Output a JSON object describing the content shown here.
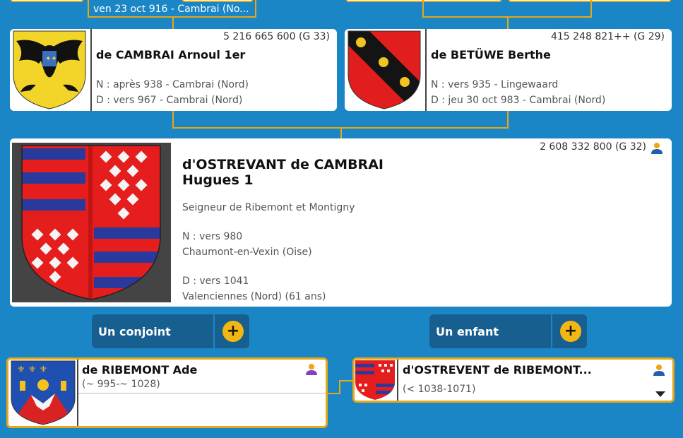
{
  "colors": {
    "background": "#1b86c6",
    "connector": "#e8a716",
    "button": "#175f8f",
    "plus": "#f2b713"
  },
  "top_marriage": {
    "text": "ven 23 oct 916 - Cambrai (No..."
  },
  "father": {
    "sosa": "5 216 665 600 (G 33)",
    "name": "de CAMBRAI Arnoul 1er",
    "birth": "N : après 938 - Cambrai (Nord)",
    "death": "D : vers 967 - Cambrai (Nord)"
  },
  "mother": {
    "sosa": "415 248 821++ (G 29)",
    "name": "de BETÜWE Berthe",
    "birth": "N : vers 935 - Lingewaard",
    "death": "D : jeu 30 oct 983 - Cambrai (Nord)"
  },
  "main": {
    "sosa": "2 608 332 800 (G 32)",
    "surname": "d'OSTREVANT de CAMBRAI",
    "given": "Hugues 1",
    "title": "Seigneur de Ribemont et Montigny",
    "birth": "N : vers 980",
    "birth_place": "Chaumont-en-Vexin (Oise)",
    "death": "D : vers 1041",
    "death_place": "Valenciennes (Nord) (61 ans)",
    "person_icon": "person-icon"
  },
  "buttons": {
    "spouse": "Un conjoint",
    "child": "Un enfant",
    "plus": "+"
  },
  "spouse": {
    "name": "de RIBEMONT Ade",
    "dates": "(~ 995-~ 1028)",
    "person_icon": "person-female-icon"
  },
  "child": {
    "name": "d'OSTREVENT de RIBEMONT...",
    "dates": "(< 1038-1071)",
    "person_icon": "person-icon",
    "expand_icon": "caret-down-icon"
  }
}
